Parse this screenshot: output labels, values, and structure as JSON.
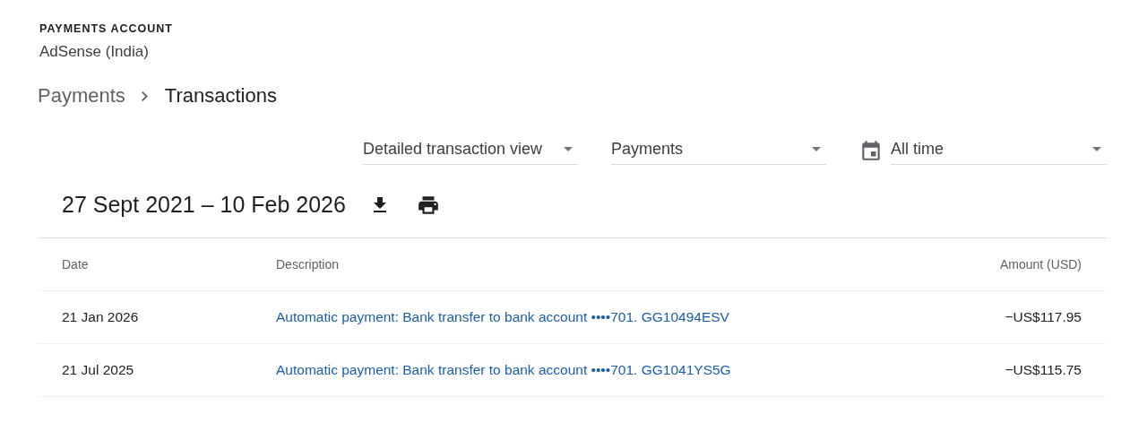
{
  "account": {
    "label": "PAYMENTS ACCOUNT",
    "name": "AdSense (India)"
  },
  "breadcrumb": [
    {
      "label": "Payments",
      "current": false
    },
    {
      "label": "Transactions",
      "current": true
    }
  ],
  "filters": [
    {
      "kind": "select",
      "value": "Detailed transaction view"
    },
    {
      "kind": "select",
      "value": "Payments"
    },
    {
      "kind": "date",
      "value": "All time"
    }
  ],
  "period": {
    "title": "27 Sept 2021 – 10 Feb 2026"
  },
  "table": {
    "columns": [
      "Date",
      "Description",
      "Amount (USD)"
    ],
    "rows": [
      {
        "date": "21 Jan 2026",
        "description": "Automatic payment: Bank transfer to bank account ••••701. GG10494ESV",
        "amount": "−US$117.95"
      },
      {
        "date": "21 Jul 2025",
        "description": "Automatic payment: Bank transfer to bank account ••••701. GG1041YS5G",
        "amount": "−US$115.75"
      }
    ]
  }
}
